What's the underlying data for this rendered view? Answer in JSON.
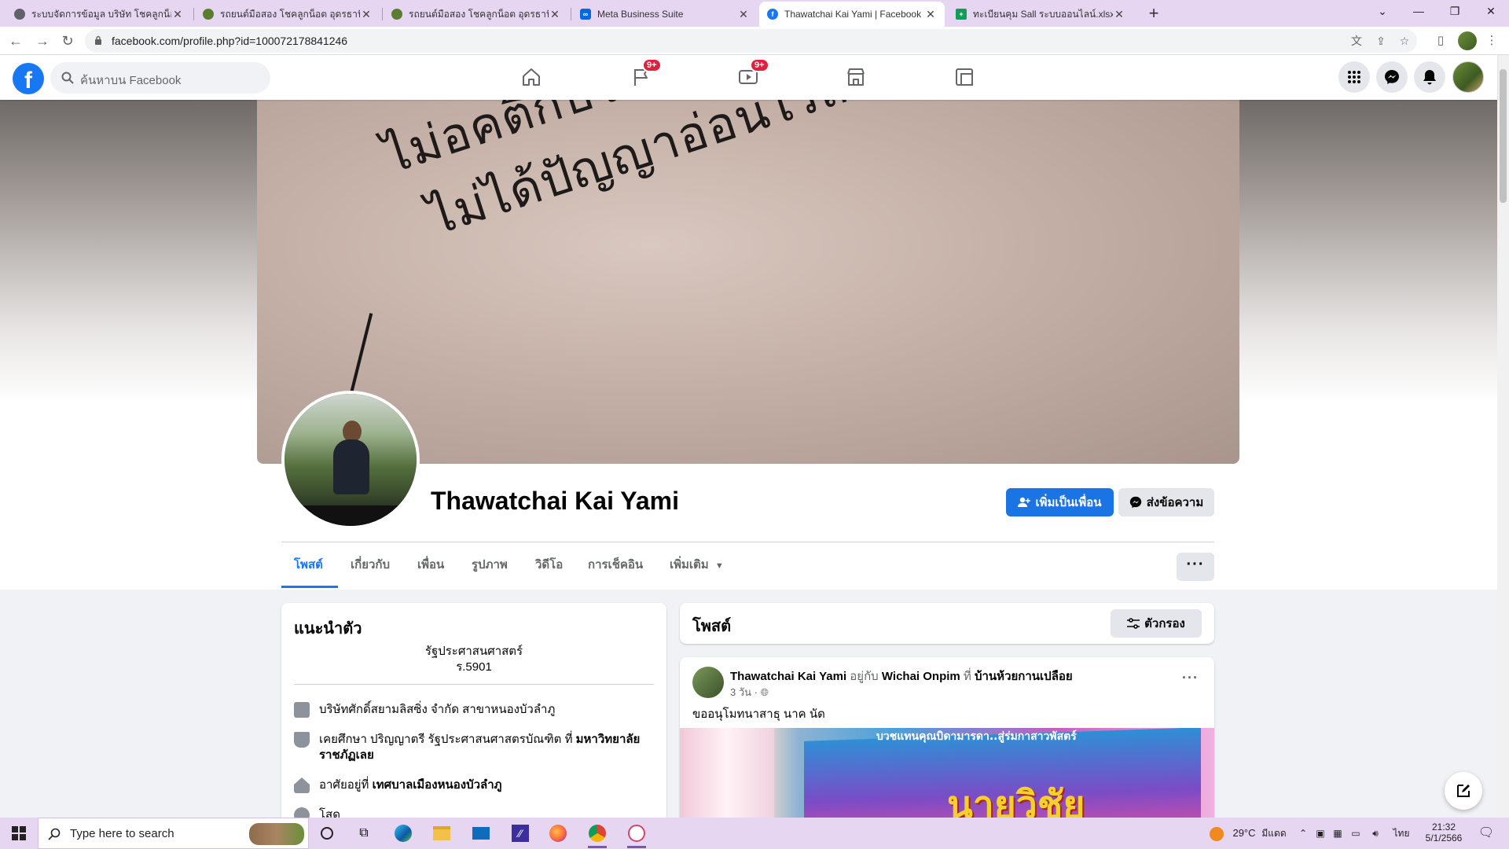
{
  "browser": {
    "tabs": [
      {
        "title": "ระบบจัดการข้อมูล บริษัท โชคลูกน็อต อ",
        "favicon_color": "#5f6368",
        "active": false
      },
      {
        "title": "รถยนต์มือสอง โชคลูกน็อต อุดรธานี",
        "favicon_color": "#5a7d2e",
        "active": false
      },
      {
        "title": "รถยนต์มือสอง โชคลูกน็อต อุดรธานี",
        "favicon_color": "#5a7d2e",
        "active": false
      },
      {
        "title": "Meta Business Suite",
        "favicon_color": "#0668e1",
        "active": false
      },
      {
        "title": "Thawatchai Kai Yami | Facebook",
        "favicon_color": "#1877f2",
        "active": true
      },
      {
        "title": "ทะเบียนคุม Sall ระบบออนไลน์.xlsx - G",
        "favicon_color": "#0f9d58",
        "active": false
      }
    ],
    "new_tab_label": "+",
    "url": "facebook.com/profile.php?id=100072178841246"
  },
  "facebook_nav": {
    "logo_letter": "f",
    "search_placeholder": "ค้นหาบน Facebook",
    "pages_badge": "9+",
    "watch_badge": "9+"
  },
  "cover_quote": {
    "line1": "ไม่อคติกับใคร โตๆกันแล้ว ดีมาดีกลับ",
    "line2": "ไม่ได้ปัญญาอ่อนไร้สาระ เหนื่อย"
  },
  "profile": {
    "name": "Thawatchai Kai Yami",
    "add_friend_label": "เพิ่มเป็นเพื่อน",
    "message_label": "ส่งข้อความ",
    "tabs": [
      "โพสต์",
      "เกี่ยวกับ",
      "เพื่อน",
      "รูปภาพ",
      "วิดีโอ",
      "การเช็คอิน",
      "เพิ่มเติม"
    ],
    "more_dots": "···"
  },
  "intro": {
    "title": "แนะนำตัว",
    "bio_line1": "รัฐประศาสนศาสตร์",
    "bio_line2": "ร.5901",
    "work": "บริษัทศักดิ์สยามลิสซิ่ง จำกัด สาขาหนองบัวลำภู",
    "edu_prefix": "เคยศึกษา ปริญญาตรี รัฐประศาสนศาสตรบัณฑิต ที่ ",
    "edu_school": "มหาวิทยาลัยราชภัฏเลย",
    "lives_prefix": "อาศัยอยู่ที่ ",
    "lives_place": "เทศบาลเมืองหนองบัวลำภู",
    "relationship": "โสด"
  },
  "posts_section": {
    "title": "โพสต์",
    "filter_label": "ตัวกรอง"
  },
  "post": {
    "author": "Thawatchai Kai Yami",
    "with_word": "อยู่กับ",
    "with_name": "Wichai Onpim",
    "at_word": "ที่",
    "place": "บ้านห้วยกานเปลือย",
    "time": "3 วัน",
    "text": "ขออนุโมทนาสาธุ นาค นัด",
    "image_banner": "บวชแทนคุณบิดามารดา..สู่ร่มกาสาวพัสตร์",
    "image_big": "นายวิชัย"
  },
  "taskbar": {
    "search_placeholder": "Type here to search",
    "temperature": "29°C",
    "weather_text": "มีแดด",
    "language": "ไทย",
    "time": "21:32",
    "date": "5/1/2566"
  }
}
